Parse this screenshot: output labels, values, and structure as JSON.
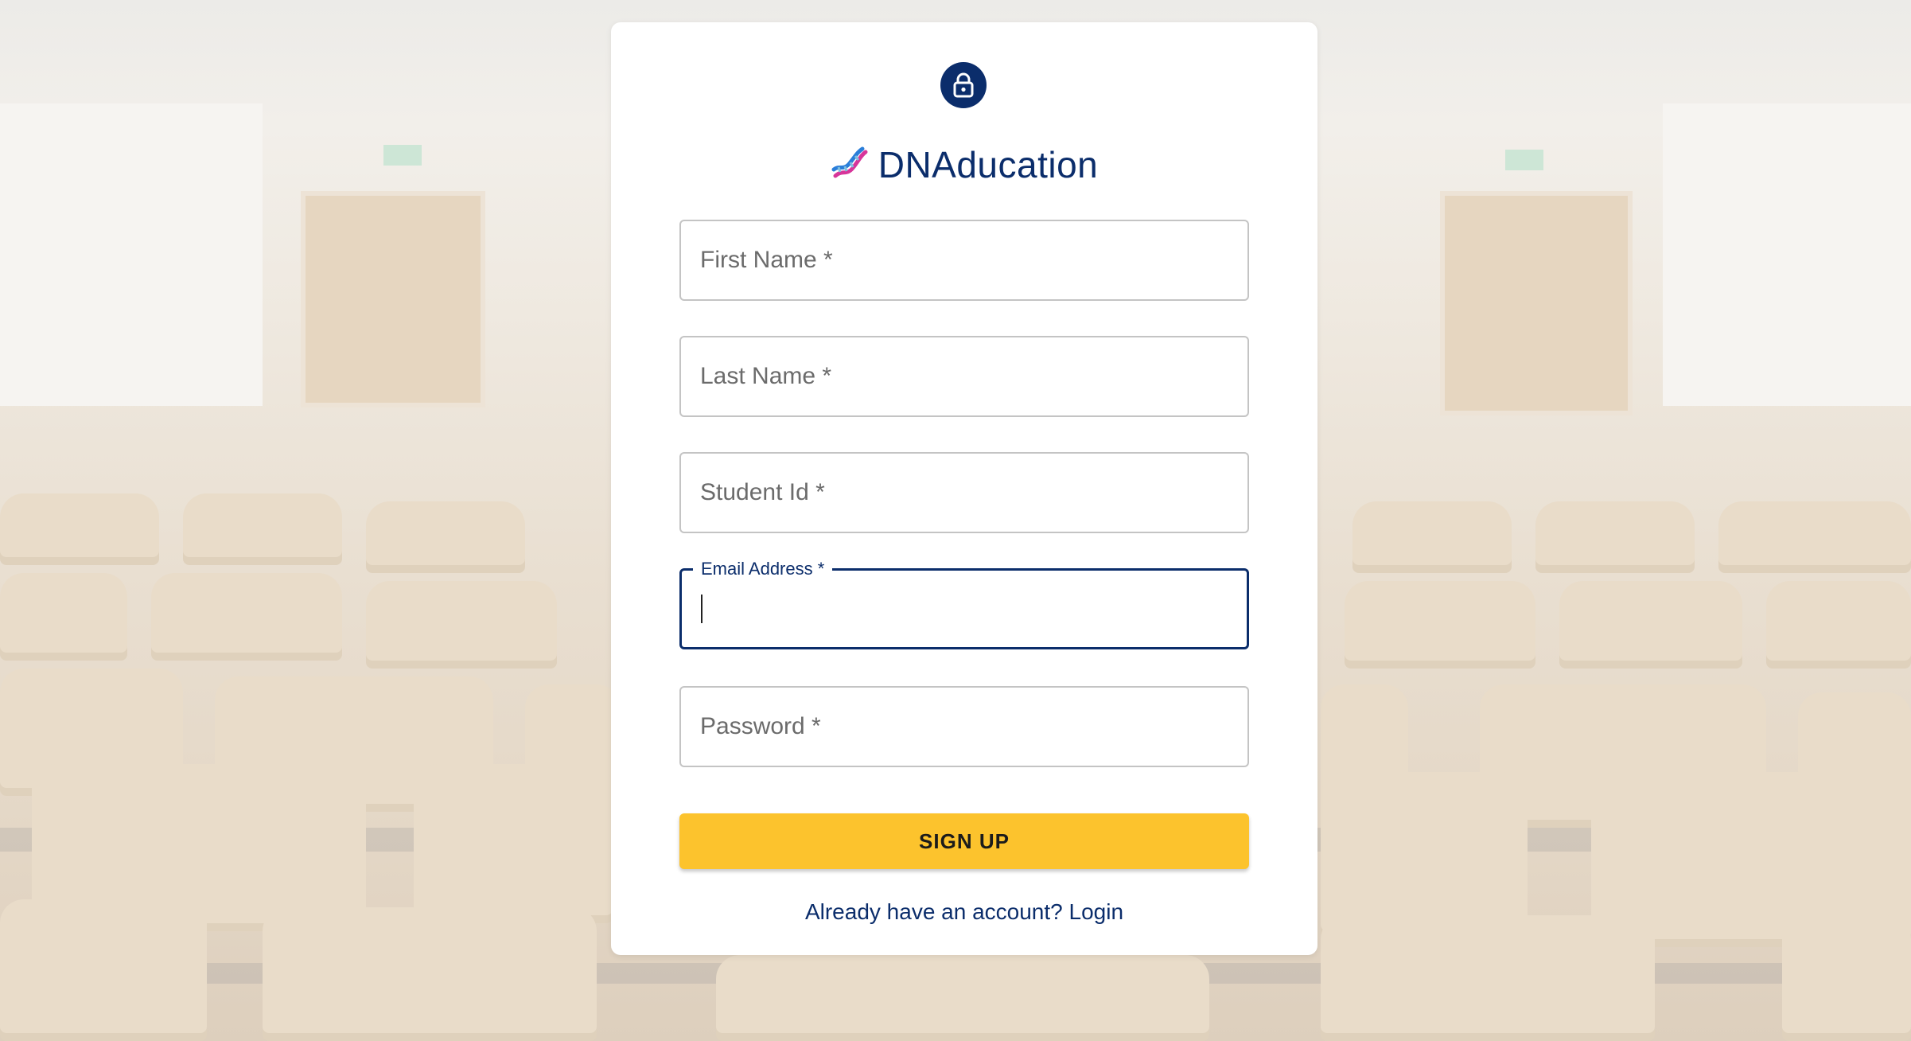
{
  "app": {
    "brand_name": "DNAducation",
    "brand_icon": "dna-icon",
    "lock_icon": "lock-icon"
  },
  "form": {
    "fields": [
      {
        "label": "First Name *",
        "value": "",
        "focused": false
      },
      {
        "label": "Last Name *",
        "value": "",
        "focused": false
      },
      {
        "label": "Student Id *",
        "value": "",
        "focused": false
      },
      {
        "label": "Email Address *",
        "value": "",
        "focused": true
      },
      {
        "label": "Password *",
        "value": "",
        "focused": false
      }
    ],
    "submit_label": "SIGN UP",
    "login_prompt": "Already have an account? Login"
  },
  "colors": {
    "primary": "#0b2d6b",
    "accent": "#fcc32d",
    "card": "#ffffff"
  }
}
